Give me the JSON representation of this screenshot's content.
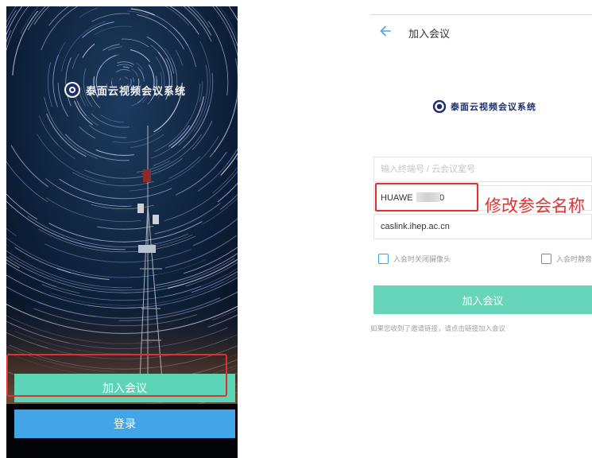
{
  "splash": {
    "logo_text": "泰面云视频会议系统",
    "join_button": "加入会议",
    "login_button": "登录",
    "colors": {
      "join": "#5cd5b6",
      "login": "#41a5e8",
      "sky": "#081424"
    }
  },
  "join_page": {
    "title": "加入会议",
    "back_icon": "arrow-left-icon",
    "logo_text": "泰面云视频会议系统",
    "conference_id": {
      "value": "",
      "placeholder": "输入终端号 / 云会议室号"
    },
    "display_name": {
      "value": "HUAWE       L00"
    },
    "server": {
      "value": "caslink.ihep.ac.cn"
    },
    "options": [
      {
        "label": "入会时关闭摄像头",
        "checked": false
      },
      {
        "label": "入会时静音",
        "checked": false
      }
    ],
    "join_button": "加入会议",
    "hint": "如果您收到了邀请链接，请点击链接加入会议",
    "colors": {
      "button": "#67d6b8",
      "checkbox": "#3a9fdd"
    }
  },
  "annotation": {
    "text": "修改参会名称",
    "color": "#e03131"
  }
}
